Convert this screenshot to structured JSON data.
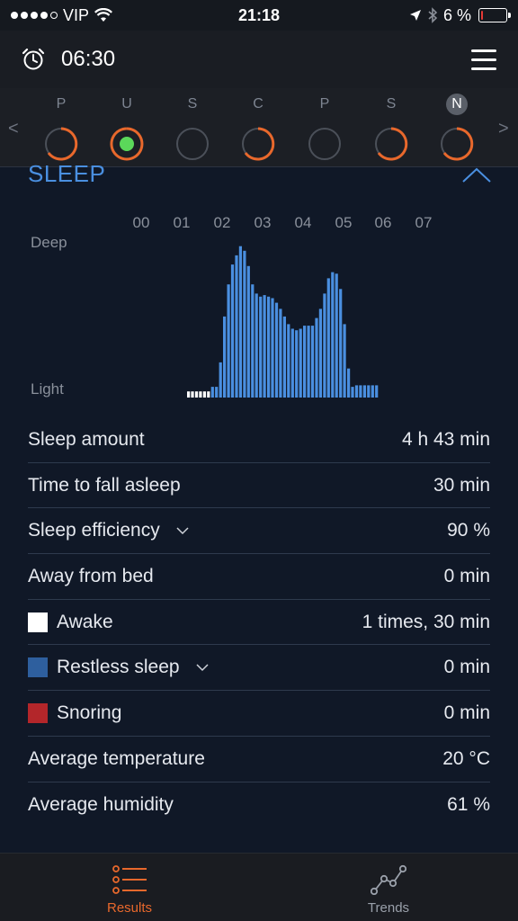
{
  "status_bar": {
    "carrier": "VIP",
    "time": "21:18",
    "battery_text": "6 %",
    "battery_level": 0.06
  },
  "header": {
    "alarm_time": "06:30"
  },
  "days": [
    {
      "letter": "P",
      "ring": "partial",
      "selected": false
    },
    {
      "letter": "U",
      "ring": "active",
      "selected": false
    },
    {
      "letter": "S",
      "ring": "empty",
      "selected": false
    },
    {
      "letter": "C",
      "ring": "partial",
      "selected": false
    },
    {
      "letter": "P",
      "ring": "empty",
      "selected": false
    },
    {
      "letter": "S",
      "ring": "partial",
      "selected": false
    },
    {
      "letter": "N",
      "ring": "partial",
      "selected": true
    }
  ],
  "day_nav": {
    "prev": "<",
    "next": ">"
  },
  "sleep": {
    "title": "SLEEP",
    "hours": [
      "00",
      "01",
      "02",
      "03",
      "04",
      "05",
      "06",
      "07"
    ],
    "axis_top": "Deep",
    "axis_bottom": "Light"
  },
  "chart_data": {
    "type": "bar",
    "x_labels": [
      "00",
      "01",
      "02",
      "03",
      "04",
      "05",
      "06",
      "07"
    ],
    "y_labels": [
      "Deep",
      "Light"
    ],
    "awake_values": [
      0.04,
      0.04,
      0.04,
      0.04,
      0.04,
      0.04
    ],
    "sleep_values": [
      0.07,
      0.07,
      0.23,
      0.53,
      0.74,
      0.87,
      0.93,
      0.99,
      0.96,
      0.86,
      0.74,
      0.68,
      0.66,
      0.67,
      0.66,
      0.65,
      0.62,
      0.58,
      0.53,
      0.48,
      0.45,
      0.44,
      0.45,
      0.47,
      0.47,
      0.47,
      0.52,
      0.58,
      0.68,
      0.78,
      0.82,
      0.81,
      0.71,
      0.48,
      0.19,
      0.07,
      0.08,
      0.08,
      0.08,
      0.08,
      0.08,
      0.08
    ],
    "colors": {
      "sleep": "#4a8fe0",
      "awake": "#ffffff"
    }
  },
  "stats": [
    {
      "label": "Sleep amount",
      "value": "4 h 43 min"
    },
    {
      "label": "Time to fall asleep",
      "value": "30 min"
    },
    {
      "label": "Sleep efficiency",
      "value": "90 %",
      "dropdown": true
    },
    {
      "label": "Away from bed",
      "value": "0 min"
    },
    {
      "label": "Awake",
      "value": "1 times, 30 min",
      "swatch": "#ffffff"
    },
    {
      "label": "Restless sleep",
      "value": "0 min",
      "swatch": "#2e5f9e",
      "dropdown": true
    },
    {
      "label": "Snoring",
      "value": "0 min",
      "swatch": "#b3262a"
    },
    {
      "label": "Average temperature",
      "value": "20 °C"
    },
    {
      "label": "Average humidity",
      "value": "61 %"
    }
  ],
  "tabs": [
    {
      "label": "Results",
      "icon": "results-list-icon",
      "active": true
    },
    {
      "label": "Trends",
      "icon": "trends-graph-icon",
      "active": false
    }
  ],
  "colors": {
    "accent": "#e8682c",
    "blue": "#4a8fe0",
    "active_dot": "#5bd85a"
  }
}
